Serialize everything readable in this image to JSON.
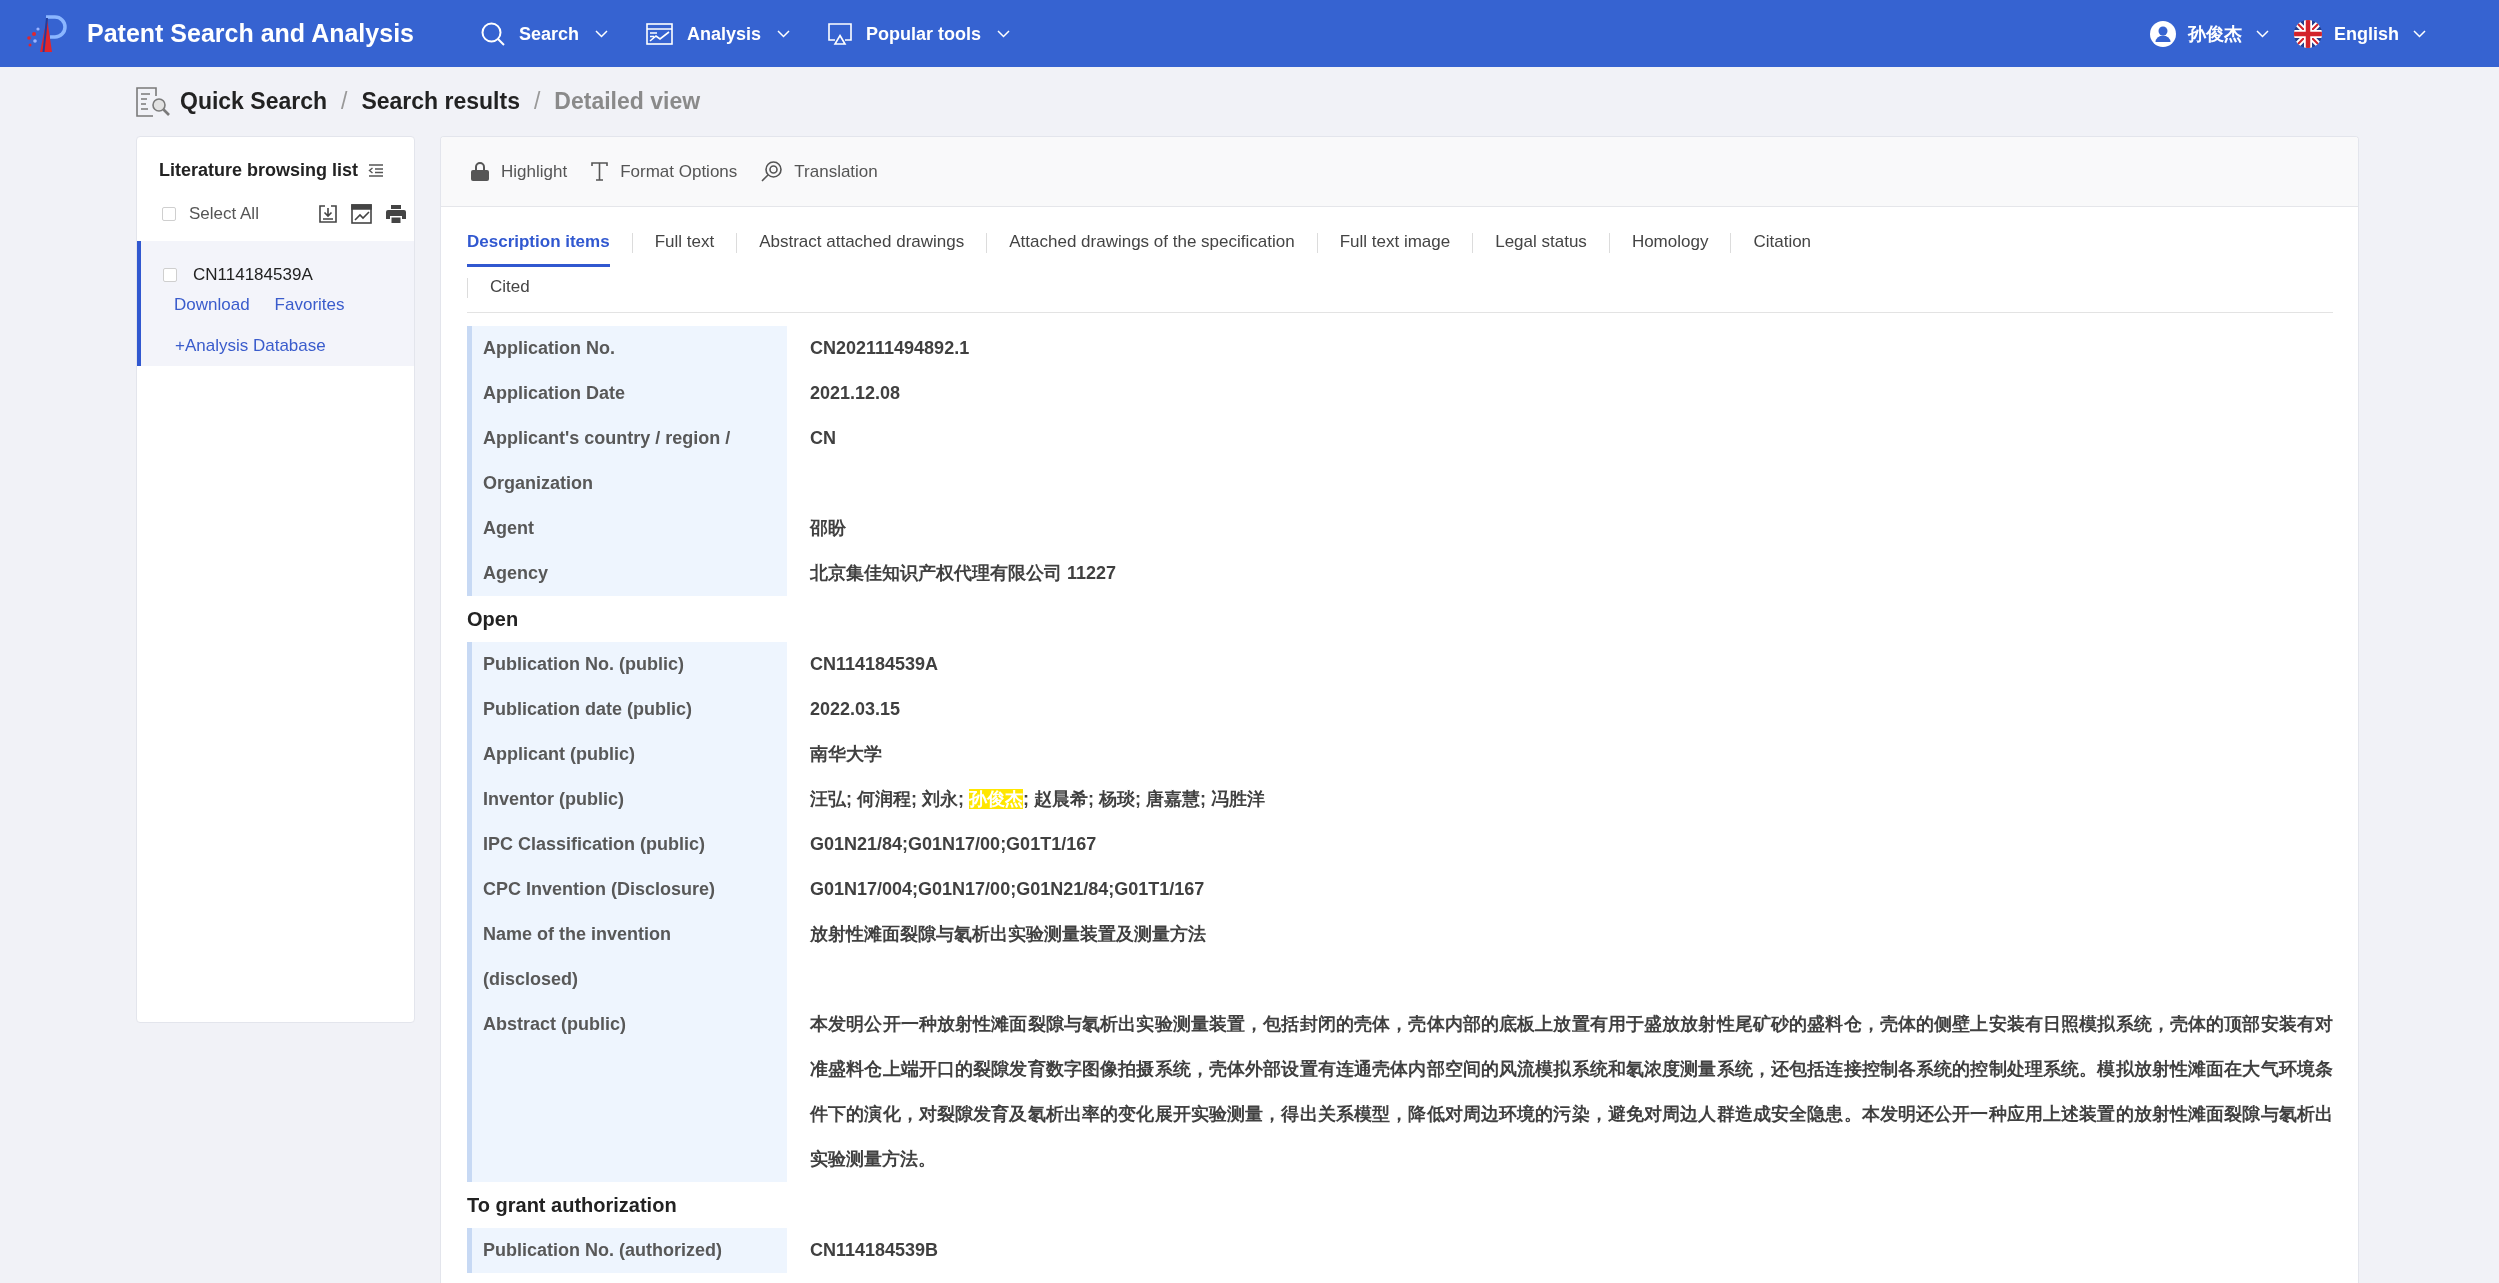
{
  "navbar": {
    "brand": "Patent Search and Analysis",
    "menus": [
      {
        "label": "Search",
        "kind": "search"
      },
      {
        "label": "Analysis",
        "kind": "analysis"
      },
      {
        "label": "Popular tools",
        "kind": "tools"
      }
    ],
    "user": "孙俊杰",
    "language": "English"
  },
  "breadcrumb": [
    {
      "label": "Quick Search",
      "current": false
    },
    {
      "divider": "/",
      "label": "Search results",
      "current": false
    },
    {
      "divider": "/",
      "label": "Detailed view",
      "current": true
    }
  ],
  "sidebar": {
    "title": "Literature browsing list",
    "select_all": {
      "label": "Select All",
      "checked": false
    },
    "items": [
      {
        "number": "CN114184539A",
        "checked": false,
        "selected": true,
        "links": [
          "Download",
          "Favorites"
        ],
        "add_link": "+Analysis Database"
      }
    ]
  },
  "toolbar": [
    {
      "label": "Highlight",
      "kind": "highlight"
    },
    {
      "label": "Format Options",
      "kind": "format"
    },
    {
      "label": "Translation",
      "kind": "translation"
    }
  ],
  "tabs": [
    {
      "label": "Description items",
      "selected": true
    },
    {
      "label": "Full text",
      "selected": false
    },
    {
      "label": "Abstract attached drawings",
      "selected": false
    },
    {
      "label": "Attached drawings of the specification",
      "selected": false
    },
    {
      "label": "Full text image",
      "selected": false
    },
    {
      "label": "Legal status",
      "selected": false
    },
    {
      "label": "Homology",
      "selected": false
    },
    {
      "label": "Citation",
      "selected": false
    },
    {
      "label": "Cited",
      "selected": false
    }
  ],
  "sections": [
    {
      "rows": [
        {
          "label": "Application No.",
          "value": "CN202111494892.1"
        },
        {
          "label": "Application Date",
          "value": "2021.12.08"
        },
        {
          "label": "Applicant's country / region / Organization",
          "value": "CN"
        },
        {
          "label": "Agent",
          "value": "邵盼"
        },
        {
          "label": "Agency",
          "value": "北京集佳知识产权代理有限公司 11227"
        }
      ]
    },
    {
      "heading": "Open",
      "rows": [
        {
          "label": "Publication No. (public)",
          "value": "CN114184539A"
        },
        {
          "label": "Publication date (public)",
          "value": "2022.03.15"
        },
        {
          "label": "Applicant (public)",
          "value": "南华大学"
        },
        {
          "label": "Inventor (public)",
          "parts": [
            {
              "text": "汪弘; 何润程; 刘永; ",
              "highlighted": false
            },
            {
              "text": "孙俊杰",
              "highlighted": true
            },
            {
              "text": "; 赵晨希; 杨琰; 唐嘉慧; 冯胜洋",
              "highlighted": false
            }
          ]
        },
        {
          "label": "IPC Classification (public)",
          "value": "G01N21/84;G01N17/00;G01T1/167"
        },
        {
          "label": "CPC Invention (Disclosure)",
          "value": "G01N17/004;G01N17/00;G01N21/84;G01T1/167"
        },
        {
          "label": "Name of the invention (disclosed)",
          "value": "放射性滩面裂隙与氡析出实验测量装置及测量方法"
        },
        {
          "label": "Abstract (public)",
          "value": "本发明公开一种放射性滩面裂隙与氡析出实验测量装置，包括封闭的壳体，壳体内部的底板上放置有用于盛放放射性尾矿砂的盛料仓，壳体的侧壁上安装有日照模拟系统，壳体的顶部安装有对准盛料仓上端开口的裂隙发育数字图像拍摄系统，壳体外部设置有连通壳体内部空间的风流模拟系统和氡浓度测量系统，还包括连接控制各系统的控制处理系统。模拟放射性滩面在大气环境条件下的演化，对裂隙发育及氡析出率的变化展开实验测量，得出关系模型，降低对周边环境的污染，避免对周边人群造成安全隐患。本发明还公开一种应用上述装置的放射性滩面裂隙与氡析出实验测量方法。"
        }
      ]
    },
    {
      "heading": "To grant authorization",
      "rows": [
        {
          "label": "Publication No. (authorized)",
          "value": "CN114184539B"
        }
      ]
    }
  ]
}
